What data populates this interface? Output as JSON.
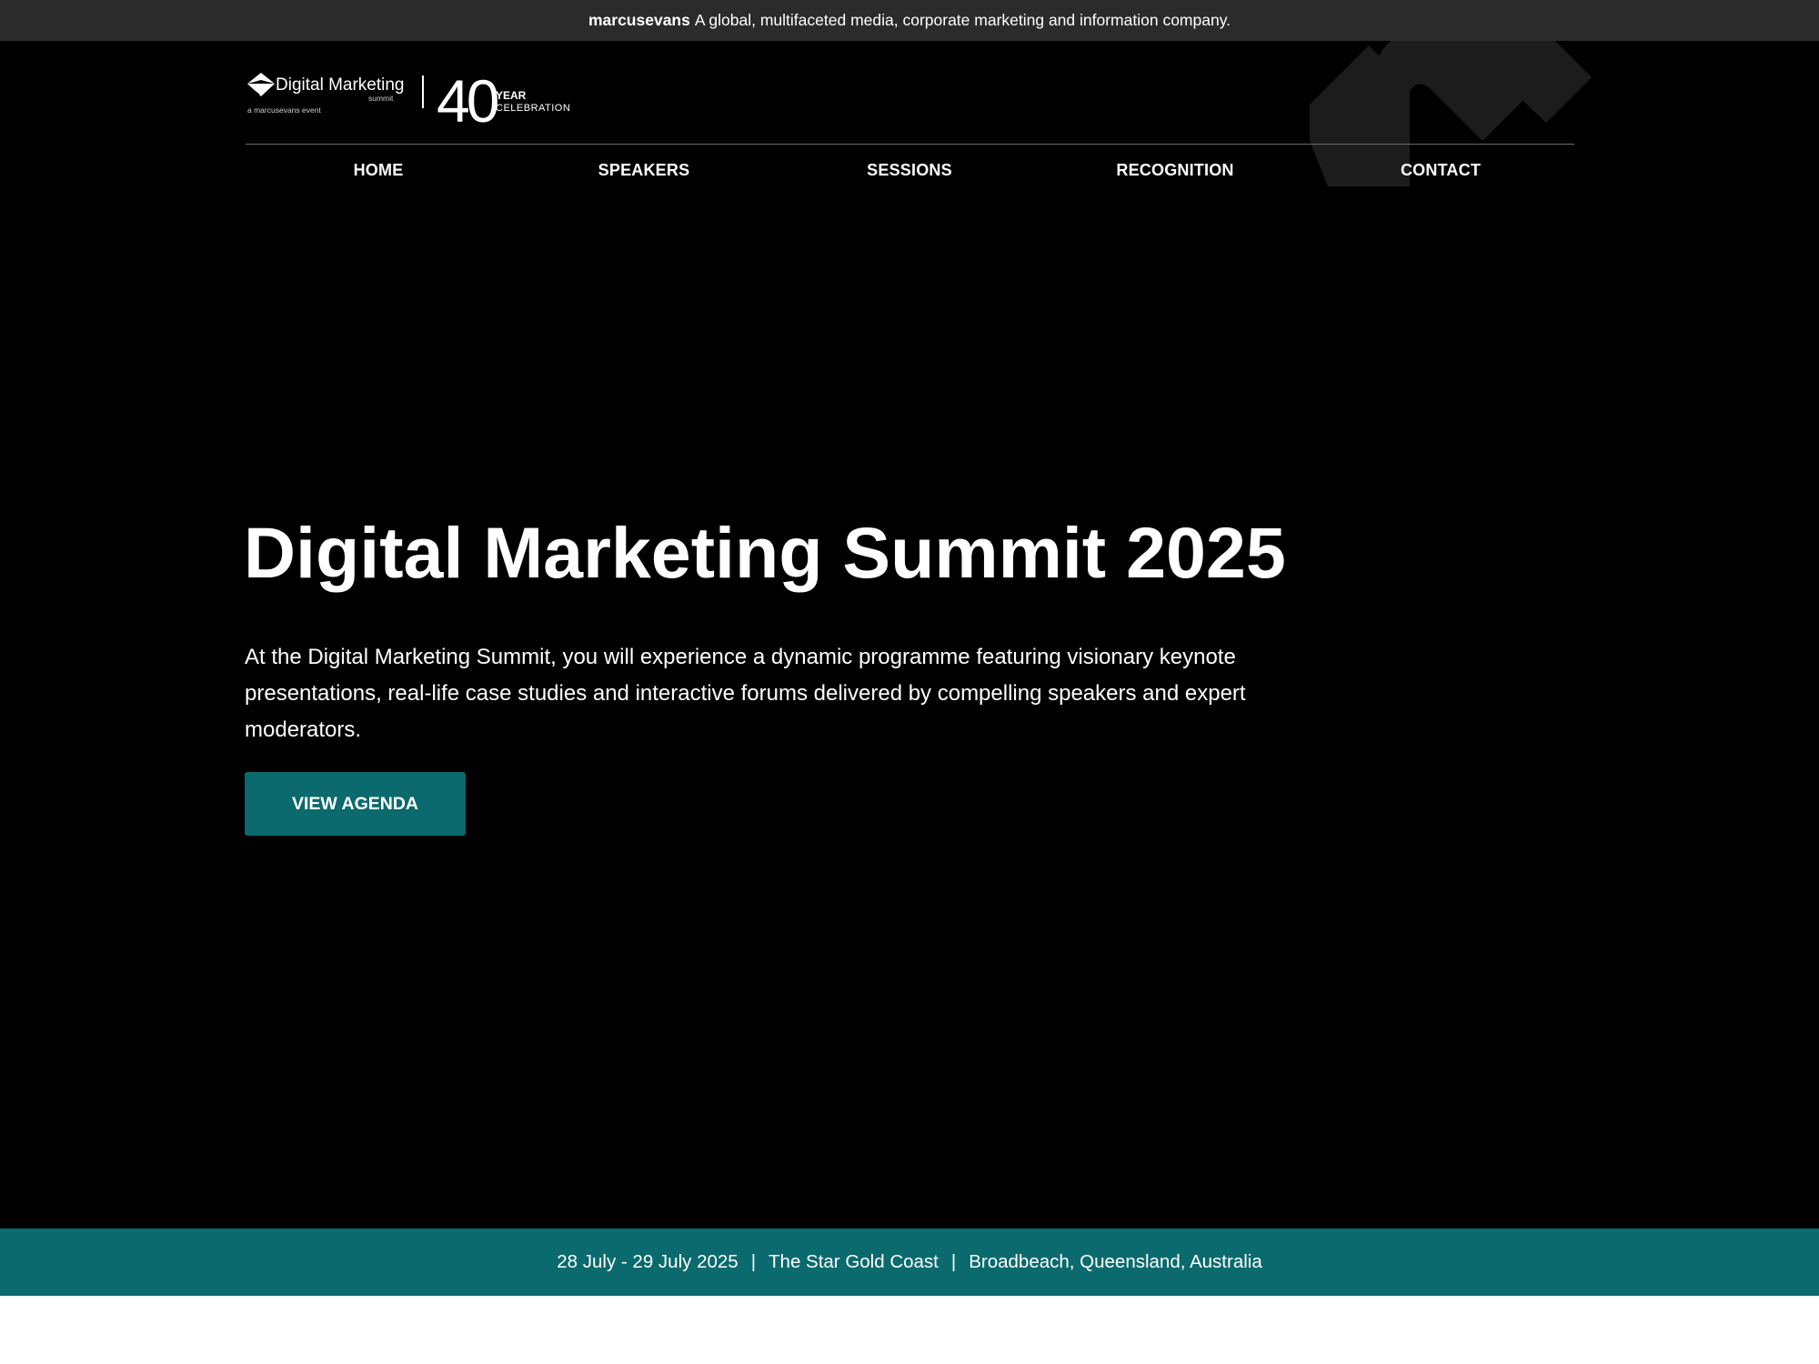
{
  "colors": {
    "topbar_bg": "#2b2b2b",
    "hero_bg": "#000000",
    "accent_teal": "#0b6a6d",
    "text": "#ffffff"
  },
  "topbar": {
    "brand": "marcusevans",
    "tagline": "A global, multifaceted media, corporate marketing and information company."
  },
  "logo": {
    "name": "Digital Marketing",
    "sub": "summit",
    "byline": "a marcusevans event",
    "anniversary_number": "40",
    "anniversary_word1": "YEAR",
    "anniversary_word2": "CELEBRATION"
  },
  "nav": {
    "items": [
      {
        "label": "HOME"
      },
      {
        "label": "SPEAKERS"
      },
      {
        "label": "SESSIONS"
      },
      {
        "label": "RECOGNITION"
      },
      {
        "label": "CONTACT"
      }
    ]
  },
  "hero": {
    "title": "Digital Marketing Summit 2025",
    "description": "At the Digital Marketing Summit, you will experience a dynamic programme featuring visionary keynote presentations, real-life case studies and interactive forums delivered by compelling speakers and expert moderators.",
    "cta_label": "VIEW AGENDA"
  },
  "event": {
    "dates": "28 July - 29 July 2025",
    "venue": "The Star Gold Coast",
    "location": "Broadbeach, Queensland, Australia",
    "separator": "|"
  },
  "icons": {
    "brand_mark": "chevron-arrow-icon",
    "decoration": "abstract-m-shape"
  }
}
